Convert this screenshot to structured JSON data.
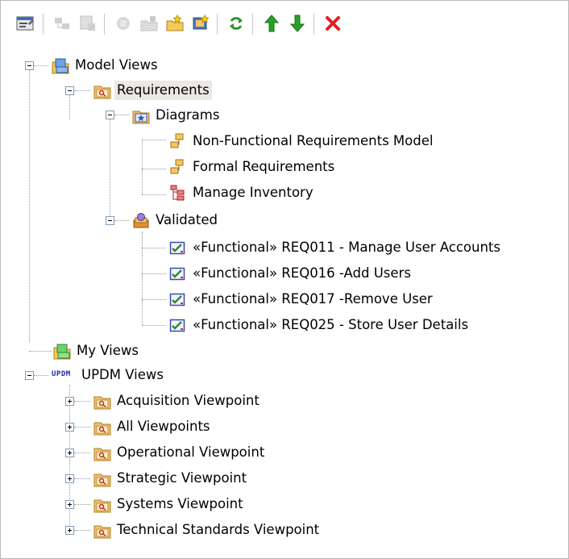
{
  "toolbar": {
    "buttons": [
      {
        "name": "properties-icon"
      },
      {
        "name": "new-package-icon"
      },
      {
        "name": "new-element-icon"
      },
      {
        "name": "new-diagram-icon"
      },
      {
        "name": "new-view-icon"
      },
      {
        "name": "new-model-icon"
      },
      {
        "name": "refresh-icon"
      },
      {
        "name": "move-up-icon"
      },
      {
        "name": "move-down-icon"
      },
      {
        "name": "delete-icon"
      }
    ]
  },
  "tree": {
    "model_views": "Model Views",
    "requirements": "Requirements",
    "diagrams": "Diagrams",
    "diagram_items": [
      "Non-Functional Requirements Model",
      "Formal Requirements",
      "Manage Inventory"
    ],
    "validated": "Validated",
    "validated_items": [
      "«Functional» REQ011 - Manage User Accounts",
      "«Functional» REQ016 -Add Users",
      "«Functional» REQ017 -Remove User",
      "«Functional» REQ025 - Store User Details"
    ],
    "my_views": "My Views",
    "updm_badge": "UPDM",
    "updm_views": "UPDM Views",
    "viewpoints": [
      "Acquisition Viewpoint",
      "All Viewpoints",
      "Operational Viewpoint",
      "Strategic Viewpoint",
      "Systems Viewpoint",
      "Technical Standards Viewpoint"
    ]
  },
  "colors": {
    "selection": "#ebe9e4",
    "folder": "#f0c070",
    "check": "#2e8b2e",
    "delete": "#e02020"
  }
}
